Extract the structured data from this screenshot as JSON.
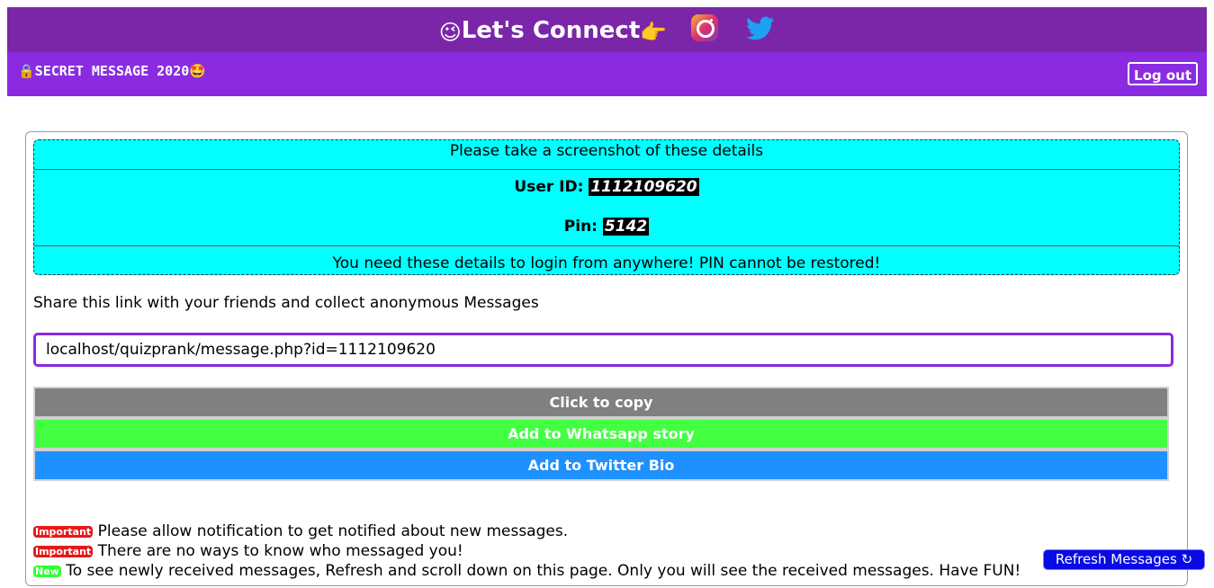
{
  "header": {
    "emoji_wink": "😉",
    "title": "Let's Connect",
    "emoji_point": "👉",
    "instagram_icon": "instagram-icon",
    "twitter_icon": "twitter-icon"
  },
  "navbar": {
    "brand": "🔒SECRET MESSAGE 2020🤩",
    "logout_label": "Log out"
  },
  "details": {
    "screenshot_note": "Please take a screenshot of these details",
    "user_id_label": "User ID:",
    "user_id_value": "1112109620",
    "pin_label": "Pin:",
    "pin_value": "5142",
    "login_note": "You need these details to login from anywhere! PIN cannot be restored!"
  },
  "share": {
    "text": "Share this link with your friends and collect anonymous Messages",
    "link_value": "localhost/quizprank/message.php?id=1112109620"
  },
  "buttons": {
    "copy": "Click to copy",
    "whatsapp": "Add to Whatsapp story",
    "twitter": "Add to Twitter Bio"
  },
  "notes": [
    {
      "badge": "Important",
      "text": "Please allow notification to get notified about new messages."
    },
    {
      "badge": "Important",
      "text": "There are no ways to know who messaged you!"
    },
    {
      "badge": "New",
      "text": "To see newly received messages, Refresh and scroll down on this page. Only you will see the received messages. Have FUN!"
    }
  ],
  "refresh_label": "Refresh Messages ↻",
  "colors": {
    "header_bg": "#7b26a8",
    "navbar_bg": "#8a2be2",
    "details_bg": "#00ffff",
    "copy_btn": "#808080",
    "whatsapp_btn": "#42ff42",
    "twitter_btn": "#1e90ff",
    "refresh_btn": "#0a0ae6"
  }
}
